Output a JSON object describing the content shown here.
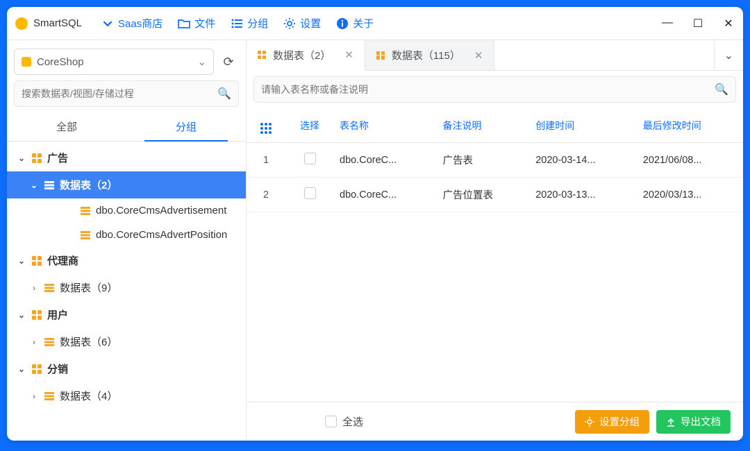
{
  "app": {
    "title": "SmartSQL"
  },
  "menu": {
    "saas": "Saas商店",
    "file": "文件",
    "group": "分组",
    "settings": "设置",
    "about": "关于"
  },
  "sidebar": {
    "db_name": "CoreShop",
    "search_placeholder": "搜索数据表/视图/存储过程",
    "tabs": {
      "all": "全部",
      "grouped": "分组"
    },
    "tree": {
      "t0": {
        "label": "广告"
      },
      "t0c": {
        "label": "数据表（2）"
      },
      "t0c0": {
        "label": "dbo.CoreCmsAdvertisement"
      },
      "t0c1": {
        "label": "dbo.CoreCmsAdvertPosition"
      },
      "t1": {
        "label": "代理商"
      },
      "t1c": {
        "label": "数据表（9）"
      },
      "t2": {
        "label": "用户"
      },
      "t2c": {
        "label": "数据表（6）"
      },
      "t3": {
        "label": "分销"
      },
      "t3c": {
        "label": "数据表（4）"
      }
    }
  },
  "main": {
    "tabs": [
      {
        "label": "数据表（2）"
      },
      {
        "label": "数据表（115）"
      }
    ],
    "search_placeholder": "请输入表名称或备注说明",
    "cols": {
      "select": "选择",
      "name": "表名称",
      "remark": "备注说明",
      "created": "创建时间",
      "modified": "最后修改时间"
    },
    "rows": [
      {
        "idx": "1",
        "name": "dbo.CoreC...",
        "remark": "广告表",
        "created": "2020-03-14...",
        "modified": "2021/06/08..."
      },
      {
        "idx": "2",
        "name": "dbo.CoreC...",
        "remark": "广告位置表",
        "created": "2020-03-13...",
        "modified": "2020/03/13..."
      }
    ],
    "footer": {
      "select_all": "全选",
      "set_group": "设置分组",
      "export": "导出文档"
    }
  }
}
